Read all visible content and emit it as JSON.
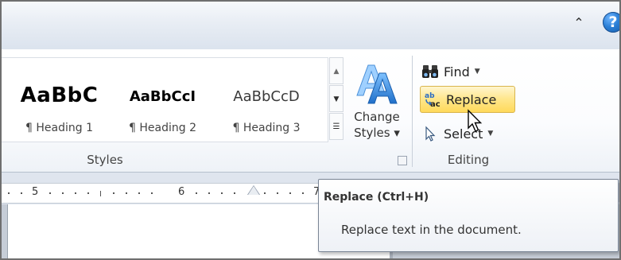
{
  "titlebar": {
    "caret_icon": "ribbon-collapse-icon",
    "help_icon": "help-icon",
    "help_symbol": "?"
  },
  "styles_group": {
    "label": "Styles",
    "tiles": [
      {
        "sample": "AaBbC",
        "name": "¶ Heading 1"
      },
      {
        "sample": "AaBbCcI",
        "name": "¶ Heading 2"
      },
      {
        "sample": "AaBbCcD",
        "name": "¶ Heading 3"
      }
    ],
    "change_styles": {
      "line1": "Change",
      "line2": "Styles ▾"
    }
  },
  "editing_group": {
    "label": "Editing",
    "find": "Find",
    "replace": "Replace",
    "select": "Select"
  },
  "ruler": {
    "numbers": [
      "5",
      "6",
      "7"
    ]
  },
  "tooltip": {
    "title": "Replace (Ctrl+H)",
    "description": "Replace text in the document."
  },
  "colors": {
    "replace_highlight": "#ffe68a",
    "help_blue": "#2b7fd6",
    "change_styles_blue": "#2a7ad6"
  }
}
